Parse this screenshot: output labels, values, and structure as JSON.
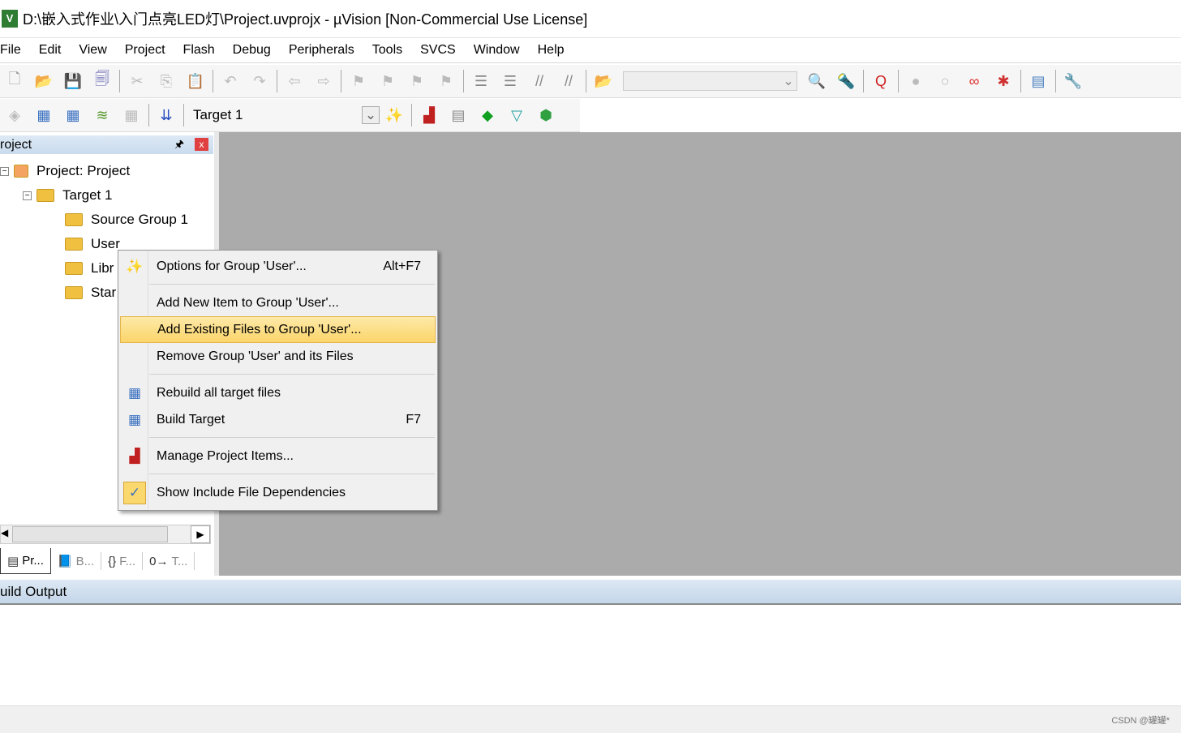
{
  "window": {
    "title": "D:\\嵌入式作业\\入门点亮LED灯\\Project.uvprojx - µVision  [Non-Commercial Use License]",
    "icon": "uvision-logo-icon",
    "icon_text": "V"
  },
  "menu": [
    "File",
    "Edit",
    "View",
    "Project",
    "Flash",
    "Debug",
    "Peripherals",
    "Tools",
    "SVCS",
    "Window",
    "Help"
  ],
  "toolbar1": [
    {
      "name": "new-file-icon",
      "glyph": "🗋",
      "color": "#999"
    },
    {
      "name": "open-folder-icon",
      "glyph": "📂",
      "color": "#d9a520"
    },
    {
      "name": "save-icon",
      "glyph": "💾",
      "color": "#aaa"
    },
    {
      "name": "save-all-icon",
      "glyph": "🗐",
      "color": "#5a5ab0"
    },
    "sep",
    {
      "name": "cut-icon",
      "glyph": "✂",
      "color": "#bbb"
    },
    {
      "name": "copy-icon",
      "glyph": "⎘",
      "color": "#bbb"
    },
    {
      "name": "paste-icon",
      "glyph": "📋",
      "color": "#bbb"
    },
    "sep",
    {
      "name": "undo-icon",
      "glyph": "↶",
      "color": "#bbb"
    },
    {
      "name": "redo-icon",
      "glyph": "↷",
      "color": "#bbb"
    },
    "sep",
    {
      "name": "navigate-back-icon",
      "glyph": "⇦",
      "color": "#bbb"
    },
    {
      "name": "navigate-forward-icon",
      "glyph": "⇨",
      "color": "#bbb"
    },
    "sep",
    {
      "name": "bookmark-icon",
      "glyph": "⚑",
      "color": "#bbb"
    },
    {
      "name": "prev-bookmark-icon",
      "glyph": "⚑",
      "color": "#bbb"
    },
    {
      "name": "next-bookmark-icon",
      "glyph": "⚑",
      "color": "#bbb"
    },
    {
      "name": "clear-bookmarks-icon",
      "glyph": "⚑",
      "color": "#bbb"
    },
    "sep",
    {
      "name": "indent-icon",
      "glyph": "☰",
      "color": "#888"
    },
    {
      "name": "unindent-icon",
      "glyph": "☰",
      "color": "#888"
    },
    {
      "name": "comment-icon",
      "glyph": "//",
      "color": "#888"
    },
    {
      "name": "uncomment-icon",
      "glyph": "//",
      "color": "#888"
    },
    "sep",
    {
      "name": "find-in-files-icon",
      "glyph": "📂",
      "color": "#d9a520"
    },
    "combo",
    {
      "name": "find-icon",
      "glyph": "🔍",
      "color": "#333"
    },
    {
      "name": "incremental-find-icon",
      "glyph": "🔦",
      "color": "#aaa"
    },
    "sep",
    {
      "name": "debug-session-icon",
      "glyph": "Q",
      "color": "#d02020"
    },
    "sep",
    {
      "name": "breakpoint-icon",
      "glyph": "●",
      "color": "#bbb"
    },
    {
      "name": "disable-breakpoint-icon",
      "glyph": "○",
      "color": "#bbb"
    },
    {
      "name": "disable-all-breakpoints-icon",
      "glyph": "∞",
      "color": "#e03030"
    },
    {
      "name": "kill-breakpoints-icon",
      "glyph": "✱",
      "color": "#d03030"
    },
    "sep",
    {
      "name": "window-layout-icon",
      "glyph": "▤",
      "color": "#4a80c0"
    },
    "sep",
    {
      "name": "configure-icon",
      "glyph": "🔧",
      "color": "#4a70a0"
    }
  ],
  "toolbar2": [
    {
      "name": "translate-icon",
      "glyph": "◈",
      "color": "#bbb"
    },
    {
      "name": "build-icon",
      "glyph": "▦",
      "color": "#3a70c0"
    },
    {
      "name": "rebuild-icon",
      "glyph": "▦",
      "color": "#3a70c0"
    },
    {
      "name": "batch-build-icon",
      "glyph": "≋",
      "color": "#5a9a30"
    },
    {
      "name": "stop-build-icon",
      "glyph": "▦",
      "color": "#bbb"
    },
    "sep",
    {
      "name": "download-load-icon",
      "glyph": "⇊",
      "color": "#2a50c0"
    },
    "sep"
  ],
  "toolbar2_right": [
    {
      "name": "target-options-icon",
      "glyph": "✨",
      "color": "#2a60b0"
    },
    "sep",
    {
      "name": "manage-project-items-icon",
      "glyph": "▟",
      "color": "#c02020"
    },
    {
      "name": "select-packs-icon",
      "glyph": "▤",
      "color": "#888"
    },
    {
      "name": "manage-rte-icon",
      "glyph": "◆",
      "color": "#10a020"
    },
    {
      "name": "pack-installer-icon",
      "glyph": "▽",
      "color": "#20a0a0"
    },
    {
      "name": "software-packs-icon",
      "glyph": "⬢",
      "color": "#30a040"
    }
  ],
  "target_select": "Target 1",
  "project_panel": {
    "title": "roject",
    "pin": "🖈",
    "close": "x",
    "tree": [
      {
        "label": "Project: Project",
        "level": 0,
        "type": "project",
        "expander": "−"
      },
      {
        "label": "Target 1",
        "level": 1,
        "type": "target",
        "expander": "−"
      },
      {
        "label": "Source Group 1",
        "level": 2,
        "type": "folder"
      },
      {
        "label": "User",
        "level": 2,
        "type": "folder"
      },
      {
        "label": "Libr",
        "level": 2,
        "type": "folder"
      },
      {
        "label": "Star",
        "level": 2,
        "type": "folder"
      }
    ],
    "tabs": [
      {
        "label": "Pr...",
        "icon": "project-tab-icon",
        "glyph": "▤"
      },
      {
        "label": "B...",
        "icon": "books-tab-icon",
        "glyph": "📘"
      },
      {
        "label": "F...",
        "icon": "functions-tab-icon",
        "glyph": "{}"
      },
      {
        "label": "T...",
        "icon": "templates-tab-icon",
        "glyph": "0→"
      }
    ]
  },
  "context_menu": [
    {
      "label": "Options for Group 'User'...",
      "shortcut": "Alt+F7",
      "icon": "options-wand-icon",
      "glyph": "✨"
    },
    "sep",
    {
      "label": "Add New  Item to Group 'User'...",
      "shortcut": "",
      "icon": "",
      "glyph": ""
    },
    {
      "label": "Add Existing Files to Group 'User'...",
      "shortcut": "",
      "icon": "",
      "glyph": "",
      "highlighted": true
    },
    {
      "label": "Remove Group 'User' and its Files",
      "shortcut": "",
      "icon": "",
      "glyph": ""
    },
    "sep",
    {
      "label": "Rebuild all target files",
      "shortcut": "",
      "icon": "rebuild-icon",
      "glyph": "▦"
    },
    {
      "label": "Build Target",
      "shortcut": "F7",
      "icon": "build-icon",
      "glyph": "▦"
    },
    "sep",
    {
      "label": "Manage Project Items...",
      "shortcut": "",
      "icon": "manage-project-items-icon",
      "glyph": "▟"
    },
    "sep",
    {
      "label": "Show Include File Dependencies",
      "shortcut": "",
      "icon": "checkmark-icon",
      "glyph": "✓",
      "checked": true
    }
  ],
  "build_output": {
    "title": "uild Output"
  },
  "watermark": "CSDN @罐罐*",
  "colors": {
    "workspace": "#ababab",
    "highlight": "#fcd56a"
  }
}
